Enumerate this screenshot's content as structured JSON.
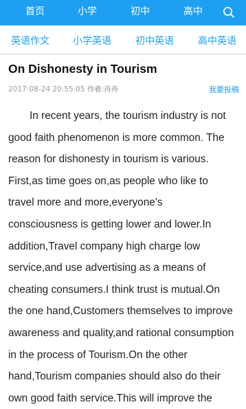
{
  "top_nav": {
    "items": [
      "首页",
      "小学",
      "初中",
      "高中"
    ]
  },
  "sub_nav": {
    "items": [
      "英语作文",
      "小学英语",
      "初中英语",
      "高中英语"
    ]
  },
  "article": {
    "title": "On Dishonesty in Tourism",
    "meta": "2017-08-24 20:55:05 作者:舟舟",
    "submit_label": "我要投稿",
    "lines": [
      "In recent years, the tourism industry is not",
      "good faith phenomenon is more common. The",
      "reason for dishonesty in tourism is various.",
      "First,as time goes on,as people who like to",
      "travel more and more,everyone's",
      "consciousness is getting lower and lower.In",
      "addition,Travel company high charge low",
      "service,and use advertising as a means of",
      "cheating consumers.I think trust is mutual.On",
      "the one hand,Customers themselves to improve",
      "awareness and quality,and rational consumption",
      "in the process of Tourism.On the other",
      "hand,Tourism companies should also do their",
      "own good faith service.This will improve the"
    ]
  },
  "colors": {
    "brand": "#1e9ff2",
    "text": "#222222",
    "meta": "#9a9a9a"
  },
  "icons": {
    "search": "search-icon"
  }
}
